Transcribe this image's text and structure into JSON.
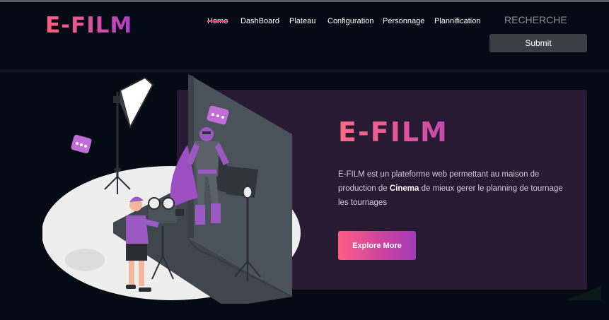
{
  "brand": {
    "logo_text": "E-FILM"
  },
  "nav": {
    "items": [
      {
        "label": "Home",
        "active": true
      },
      {
        "label": "DashBoard"
      },
      {
        "label": "Plateau"
      },
      {
        "label": "Configuration"
      },
      {
        "label": "Personnage"
      },
      {
        "label": "Plannification"
      }
    ]
  },
  "search": {
    "placeholder": "RECHERCHE",
    "submit_label": "Submit"
  },
  "hero": {
    "title": "E-FILM",
    "desc_before": "E-FILM est un plateforme web permettant au maison de production de ",
    "desc_bold": "Cinema",
    "desc_after": " de mieux gerer le planning de tournage les tournages",
    "cta_label": "Explore More"
  },
  "colors": {
    "page_bg": "#050b14",
    "panel_bg": "#281a32",
    "accent_pink": "#ff5f7e",
    "accent_purple": "#a93dc6",
    "illustration_purple": "#9b59c4"
  },
  "icons": [
    "film-studio-illustration",
    "chat-bubble-icon"
  ]
}
